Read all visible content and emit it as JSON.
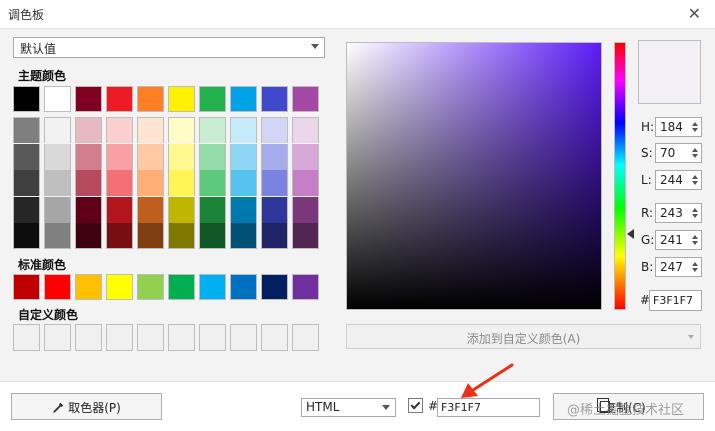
{
  "window": {
    "title": "调色板"
  },
  "preset": {
    "value": "默认值"
  },
  "sections": {
    "theme": "主题颜色",
    "standard": "标准颜色",
    "custom": "自定义颜色"
  },
  "theme_colors": [
    {
      "top": "#000000",
      "shades": [
        "#7f7f7f",
        "#595959",
        "#3f3f3f",
        "#262626",
        "#0d0d0d"
      ]
    },
    {
      "top": "#ffffff",
      "shades": [
        "#f2f2f2",
        "#d9d9d9",
        "#bfbfbf",
        "#a6a6a6",
        "#808080"
      ]
    },
    {
      "top": "#7f0020",
      "shades": [
        "#e7b9c1",
        "#d17f8e",
        "#b84a5e",
        "#5f0018",
        "#3f0010"
      ]
    },
    {
      "top": "#ed1c24",
      "shades": [
        "#fbcfd0",
        "#f8a0a2",
        "#f47074",
        "#b2151b",
        "#760e12"
      ]
    },
    {
      "top": "#ff7f27",
      "shades": [
        "#ffe4d1",
        "#ffcaa3",
        "#ffaf76",
        "#bf5f1d",
        "#7f3f13"
      ]
    },
    {
      "top": "#fff200",
      "shades": [
        "#fffcc8",
        "#fff98f",
        "#fff557",
        "#bfb600",
        "#7f7900"
      ]
    },
    {
      "top": "#22b14c",
      "shades": [
        "#c9edd3",
        "#93dca8",
        "#5dc97c",
        "#1a8539",
        "#115826"
      ]
    },
    {
      "top": "#00a2e8",
      "shades": [
        "#c6ebfa",
        "#8dd7f5",
        "#54c3f0",
        "#0079ae",
        "#005174"
      ]
    },
    {
      "top": "#3f48cc",
      "shades": [
        "#d3d5f4",
        "#a7abe9",
        "#7b82df",
        "#2f3699",
        "#1f2466"
      ]
    },
    {
      "top": "#a349a4",
      "shades": [
        "#ebd5eb",
        "#d8a9d8",
        "#c57fc6",
        "#7a377b",
        "#522552"
      ]
    }
  ],
  "standard_colors": [
    "#c00000",
    "#ff0000",
    "#ffc000",
    "#ffff00",
    "#92d050",
    "#00b050",
    "#00b0f0",
    "#0070c0",
    "#002060",
    "#7030a0"
  ],
  "custom_colors_count": 10,
  "preview_color": "#f3f1f7",
  "spectrum_hue_color": "#5c1cf8",
  "fields": {
    "h_label": "H:",
    "h": "184",
    "s_label": "S:",
    "s": "70",
    "l_label": "L:",
    "l": "244",
    "r_label": "R:",
    "r": "243",
    "g_label": "G:",
    "g": "241",
    "b_label": "B:",
    "b": "247"
  },
  "hex": {
    "label": "#",
    "value": "F3F1F7"
  },
  "add_custom": {
    "label": "添加到自定义颜色(A)"
  },
  "bottom": {
    "picker_label": "取色器(P)",
    "format": "HTML",
    "hash": "#",
    "output": "F3F1F7",
    "copy_label": "复制(C)",
    "watermark": "@稀土掘金技术社区"
  },
  "annotation_color": "#e8311a"
}
